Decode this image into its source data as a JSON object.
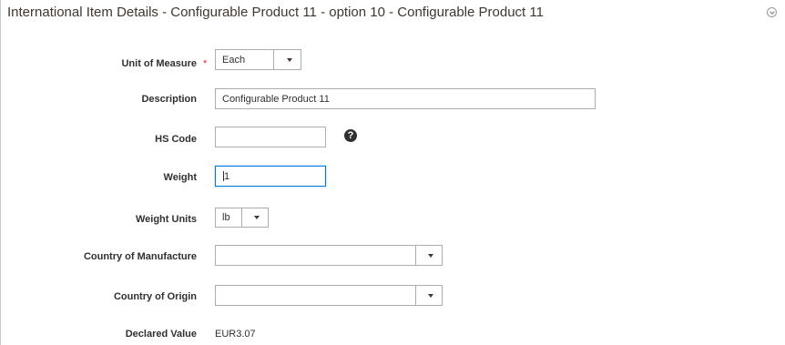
{
  "section": {
    "title": "International Item Details - Configurable Product 11 - option 10 - Configurable Product 11"
  },
  "form": {
    "unit_of_measure": {
      "label": "Unit of Measure",
      "required_mark": "*",
      "value": "Each"
    },
    "description": {
      "label": "Description",
      "value": "Configurable Product 11"
    },
    "hs_code": {
      "label": "HS Code",
      "value": "",
      "help_icon": "question-circle-icon"
    },
    "weight": {
      "label": "Weight",
      "value": "1"
    },
    "weight_units": {
      "label": "Weight Units",
      "value": "lb"
    },
    "country_of_manufacture": {
      "label": "Country of Manufacture",
      "value": ""
    },
    "country_of_origin": {
      "label": "Country of Origin",
      "value": ""
    },
    "declared_value": {
      "label": "Declared Value",
      "value": "EUR3.07"
    }
  },
  "colors": {
    "required": "#e22626",
    "focus_border": "#007bdb",
    "border": "#adadad"
  }
}
